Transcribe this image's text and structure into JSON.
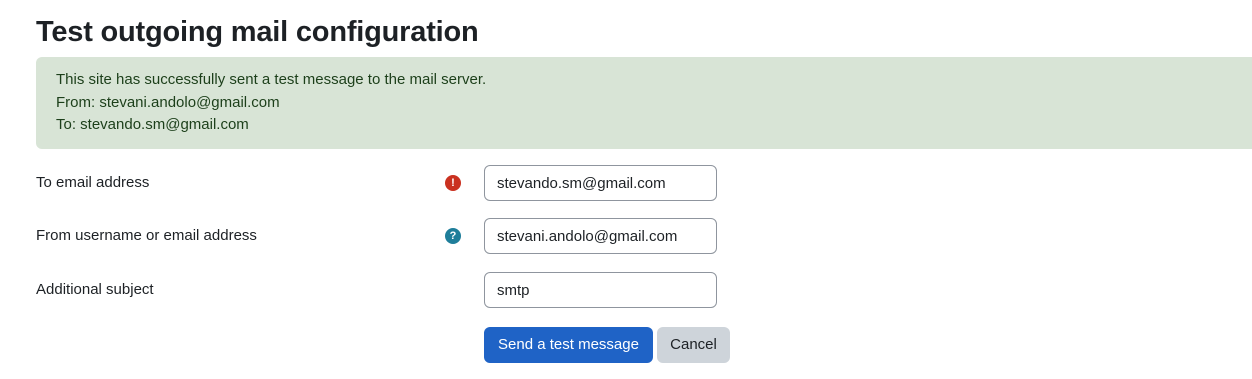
{
  "page": {
    "title": "Test outgoing mail configuration"
  },
  "alert": {
    "lines": [
      "This site has successfully sent a test message to the mail server.",
      "From: stevani.andolo@gmail.com",
      "To: stevando.sm@gmail.com"
    ],
    "background_color": "#d8e4d6"
  },
  "form": {
    "to_email": {
      "label": "To email address",
      "icon": "required-exclamation-icon",
      "icon_glyph": "!",
      "value": "stevando.sm@gmail.com"
    },
    "from_user": {
      "label": "From username or email address",
      "icon": "help-question-icon",
      "icon_glyph": "?",
      "value": "stevani.andolo@gmail.com"
    },
    "subject": {
      "label": "Additional subject",
      "value": "smtp"
    }
  },
  "actions": {
    "send_label": "Send a test message",
    "cancel_label": "Cancel",
    "primary_color": "#1f63c6"
  }
}
